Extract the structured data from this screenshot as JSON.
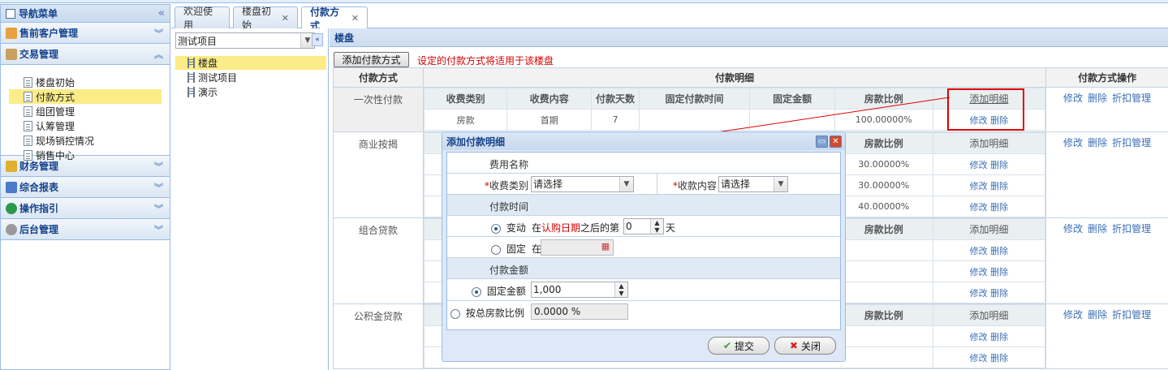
{
  "nav": {
    "title": "导航菜单",
    "sections": [
      {
        "label": "售前客户管理",
        "icon": "people-icon"
      },
      {
        "label": "交易管理",
        "icon": "house-icon"
      }
    ],
    "trade_items": [
      "楼盘初始",
      "付款方式",
      "组团管理",
      "认筹管理",
      "现场销控情况",
      "销售中心"
    ],
    "lower_sections": [
      {
        "label": "财务管理",
        "icon": "coins-icon"
      },
      {
        "label": "综合报表",
        "icon": "chart-icon"
      },
      {
        "label": "操作指引",
        "icon": "arrow-icon"
      },
      {
        "label": "后台管理",
        "icon": "gear-icon"
      }
    ]
  },
  "tabs": [
    {
      "label": "欢迎使用",
      "closable": false
    },
    {
      "label": "楼盘初始",
      "closable": true
    },
    {
      "label": "付款方式",
      "closable": true
    }
  ],
  "tree": {
    "project_select": "测试项目",
    "nodes": [
      "楼盘",
      "测试项目",
      "演示"
    ]
  },
  "main": {
    "panel_title": "楼盘",
    "add_button": "添加付款方式",
    "hint": "设定的付款方式将适用于该楼盘",
    "col_type": "付款方式",
    "col_detail": "付款明细",
    "col_ops": "付款方式操作",
    "inner_headers": [
      "收费类别",
      "收费内容",
      "付款天数",
      "固定付款时间",
      "固定金额",
      "房款比例"
    ],
    "add_detail": "添加明细",
    "edit": "修改",
    "delete": "删除",
    "discount": "折扣管理",
    "ratio_header": "房款比例",
    "rows": [
      {
        "type": "一次性付款",
        "detail": [
          {
            "cat": "房款",
            "content": "首期",
            "days": "7",
            "fixed_time": "",
            "fixed_amount": "",
            "ratio": "100.00000%"
          }
        ]
      },
      {
        "type": "商业按揭",
        "ratios": [
          "30.00000%",
          "30.00000%",
          "40.00000%"
        ]
      },
      {
        "type": "组合贷款"
      },
      {
        "type": "公积金贷款"
      }
    ]
  },
  "dialog": {
    "title": "添加付款明细",
    "fee_name_label": "费用名称",
    "category_label": "收费类别",
    "category_value": "请选择",
    "content_label": "收款内容",
    "content_value": "请选择",
    "pay_time_section": "付款时间",
    "variable_label": "变动",
    "variable_prefix": "在",
    "variable_red": "认购日期",
    "variable_middle": "之后的第",
    "variable_days": "0",
    "variable_suffix": "天",
    "fixed_label": "固定",
    "fixed_prefix": "在",
    "amount_section": "付款金额",
    "fixed_amount_label": "固定金额",
    "fixed_amount_value": "1,000",
    "ratio_label": "按总房款比例",
    "ratio_value": "0.0000 %",
    "submit": "提交",
    "close": "关闭"
  }
}
